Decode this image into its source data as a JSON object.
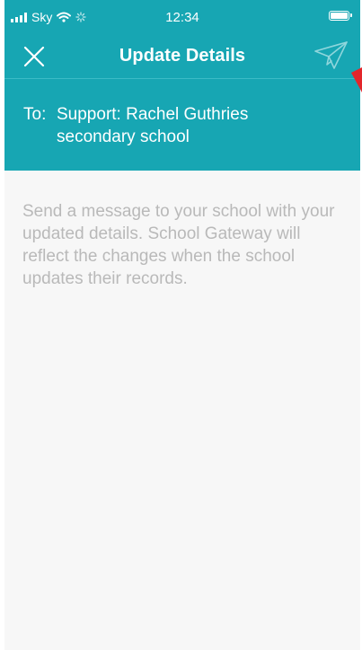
{
  "status_bar": {
    "carrier": "Sky",
    "time": "12:34"
  },
  "nav": {
    "title": "Update Details",
    "close_icon": "close-icon",
    "send_icon": "paper-plane-icon"
  },
  "recipient": {
    "label": "To:",
    "value": "Support: Rachel Guthries secondary school"
  },
  "message": {
    "placeholder": "Send a message to your school with your updated details. School Gateway will reflect the changes when the school updates their records."
  },
  "colors": {
    "accent": "#17a6b3",
    "placeholder_text": "#b9b9b9",
    "background": "#f7f7f7"
  }
}
